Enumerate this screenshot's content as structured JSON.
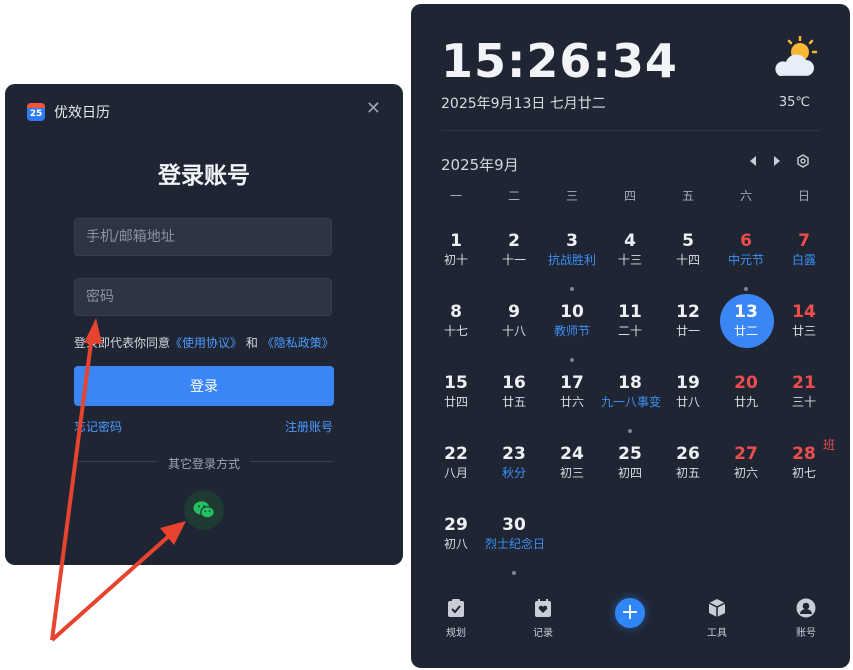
{
  "login": {
    "app_name": "优效日历",
    "app_icon_text": "25",
    "title": "登录账号",
    "phone_placeholder": "手机/邮箱地址",
    "password_placeholder": "密码",
    "agree_prefix": "登录即代表你同意",
    "terms_link": "《使用协议》",
    "agree_and": "和",
    "privacy_link": "《隐私政策》",
    "login_button": "登录",
    "forgot_password": "忘记密码",
    "register": "注册账号",
    "other_methods": "其它登录方式"
  },
  "calendar": {
    "time": "15:26:34",
    "date_line": "2025年9月13日 七月廿二",
    "temperature": "35℃",
    "month_title": "2025年9月",
    "weekdays": [
      "一",
      "二",
      "三",
      "四",
      "五",
      "六",
      "日"
    ],
    "days": [
      {
        "n": "1",
        "l": "初十",
        "red": false,
        "hol": false,
        "dot": false
      },
      {
        "n": "2",
        "l": "十一",
        "red": false,
        "hol": false,
        "dot": false
      },
      {
        "n": "3",
        "l": "抗战胜利",
        "red": false,
        "hol": true,
        "dot": true
      },
      {
        "n": "4",
        "l": "十三",
        "red": false,
        "hol": false,
        "dot": false
      },
      {
        "n": "5",
        "l": "十四",
        "red": false,
        "hol": false,
        "dot": false
      },
      {
        "n": "6",
        "l": "中元节",
        "red": true,
        "hol": true,
        "dot": true
      },
      {
        "n": "7",
        "l": "白露",
        "red": true,
        "hol": true,
        "dot": false
      },
      {
        "n": "8",
        "l": "十七",
        "red": false,
        "hol": false,
        "dot": false
      },
      {
        "n": "9",
        "l": "十八",
        "red": false,
        "hol": false,
        "dot": false
      },
      {
        "n": "10",
        "l": "教师节",
        "red": false,
        "hol": true,
        "dot": true
      },
      {
        "n": "11",
        "l": "二十",
        "red": false,
        "hol": false,
        "dot": false
      },
      {
        "n": "12",
        "l": "廿一",
        "red": false,
        "hol": false,
        "dot": false
      },
      {
        "n": "13",
        "l": "廿二",
        "red": false,
        "hol": false,
        "dot": false,
        "today": true
      },
      {
        "n": "14",
        "l": "廿三",
        "red": true,
        "hol": false,
        "dot": false
      },
      {
        "n": "15",
        "l": "廿四",
        "red": false,
        "hol": false,
        "dot": false
      },
      {
        "n": "16",
        "l": "廿五",
        "red": false,
        "hol": false,
        "dot": false
      },
      {
        "n": "17",
        "l": "廿六",
        "red": false,
        "hol": false,
        "dot": false
      },
      {
        "n": "18",
        "l": "九一八事变",
        "red": false,
        "hol": true,
        "dot": true
      },
      {
        "n": "19",
        "l": "廿八",
        "red": false,
        "hol": false,
        "dot": false
      },
      {
        "n": "20",
        "l": "廿九",
        "red": true,
        "hol": false,
        "dot": false
      },
      {
        "n": "21",
        "l": "三十",
        "red": true,
        "hol": false,
        "dot": false
      },
      {
        "n": "22",
        "l": "八月",
        "red": false,
        "hol": false,
        "dot": false
      },
      {
        "n": "23",
        "l": "秋分",
        "red": false,
        "hol": true,
        "dot": false
      },
      {
        "n": "24",
        "l": "初三",
        "red": false,
        "hol": false,
        "dot": false
      },
      {
        "n": "25",
        "l": "初四",
        "red": false,
        "hol": false,
        "dot": false
      },
      {
        "n": "26",
        "l": "初五",
        "red": false,
        "hol": false,
        "dot": false
      },
      {
        "n": "27",
        "l": "初六",
        "red": true,
        "hol": false,
        "dot": false
      },
      {
        "n": "28",
        "l": "初七",
        "red": true,
        "hol": false,
        "dot": false,
        "ban": "班"
      },
      {
        "n": "29",
        "l": "初八",
        "red": false,
        "hol": false,
        "dot": false
      },
      {
        "n": "30",
        "l": "烈士纪念日",
        "red": false,
        "hol": true,
        "dot": true
      }
    ],
    "tabs": {
      "plan": "规划",
      "record": "记录",
      "tools": "工具",
      "account": "账号"
    },
    "add_label": "+"
  },
  "colors": {
    "accent": "#3a86f7",
    "holiday_text": "#3d8ff5",
    "weekend_red": "#ef4d4d",
    "panel_bg": "#1f2533"
  }
}
